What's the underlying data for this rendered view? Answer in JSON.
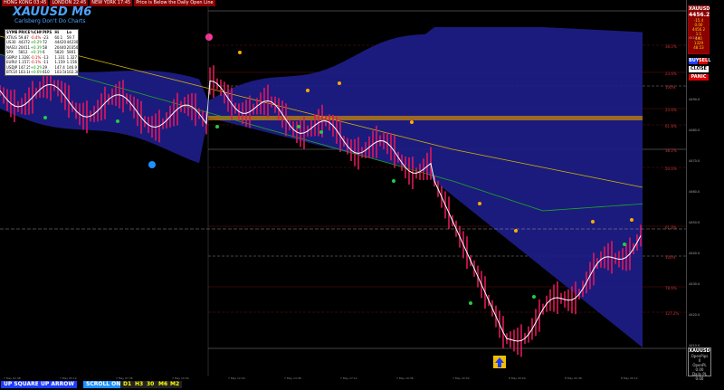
{
  "sessions": {
    "items": [
      "HONG KONG 03:45",
      "LONDON 22:45",
      "NEW YORK 17:45"
    ],
    "message": "Price is Below the Daily Open Line"
  },
  "header": {
    "symbol": "XAUUSD M6",
    "subtitle": "Carlsberg Don't Do Charts"
  },
  "watchlist": {
    "columns": [
      "SYMBOL",
      "PRICE",
      "%CHNG",
      "PIPS",
      "Hi",
      "Lo"
    ],
    "rows": [
      [
        "XTIUSD",
        "59.87",
        "-0.4%",
        "-23",
        "60.1",
        "59.7"
      ],
      [
        "US30",
        "44372",
        "+0.2%",
        "72",
        "44420",
        "44230"
      ],
      [
        "NAS100",
        "20411",
        "+0.3%",
        "58",
        "20440",
        "20350"
      ],
      [
        "SPX",
        "5812",
        "+0.1%",
        "6",
        "5820",
        "5801"
      ],
      [
        "GBPUSD",
        "1.3287",
        "-0.1%",
        "-13",
        "1.331",
        "1.327"
      ],
      [
        "EURUSD",
        "1.1573",
        "-0.1%",
        "-11",
        "1.159",
        "1.156"
      ],
      [
        "USDJPY",
        "147.25",
        "+0.2%",
        "29",
        "147.4",
        "146.9"
      ],
      [
        "BTCUSD",
        "103.1k",
        "+0.6%",
        "610",
        "103.5k",
        "102.3k"
      ]
    ]
  },
  "info_panel": {
    "pair": "XAUUSD",
    "price": "4456.2",
    "lines": [
      "-15.4",
      "0.00",
      "4456.2",
      "1:1",
      "440",
      "1329",
      "48.53"
    ]
  },
  "buttons": {
    "buy": "BUY",
    "sell": "SELL",
    "close": "CLOSE",
    "panic": "PANIC"
  },
  "side_box": {
    "pair": "XAUUSD",
    "lines": [
      "OpenPips",
      "0",
      "OpenPL",
      "0.00",
      "Daily PL",
      "0.00"
    ]
  },
  "bottom_bar": {
    "up_square": "UP SQUARE",
    "up_arrow": "UP ARROW",
    "scroll": "SCROLL ON",
    "timeframes": [
      "D1",
      "H3",
      "30",
      "M6",
      "M2"
    ]
  },
  "colors": {
    "band": "#1e1e8c",
    "candle": "#e0185a",
    "yellow_ma": "#d4b300",
    "green_ma": "#1faa1f",
    "white_ma": "#ffffff",
    "dot_orange": "#ffaa00",
    "dot_green": "#22cc44",
    "dot_blue": "#1e90ff",
    "dot_pink": "#ff3399"
  },
  "price_scale": [
    "4520.0",
    "4510.0",
    "4500.0",
    "4490.0",
    "4480.0",
    "4470.0",
    "4460.0",
    "4450.0",
    "4440.0",
    "4430.0",
    "4420.0",
    "4410.0"
  ],
  "fib_levels": [
    "38.2%",
    "23.6%",
    "100%",
    "23.6%",
    "61.8%",
    "38.2%",
    "50.0%",
    "61.8%",
    "100%",
    "78.6%",
    "127.2%"
  ],
  "time_axis_labels": [
    "7 May 02:48",
    "7 May 05:12",
    "7 May 07:36",
    "7 May 10:00",
    "7 May 12:24",
    "7 May 14:48",
    "7 May 17:12",
    "7 May 19:36",
    "7 May 22:00",
    "8 May 00:24",
    "8 May 02:48",
    "8 May 05:12"
  ]
}
